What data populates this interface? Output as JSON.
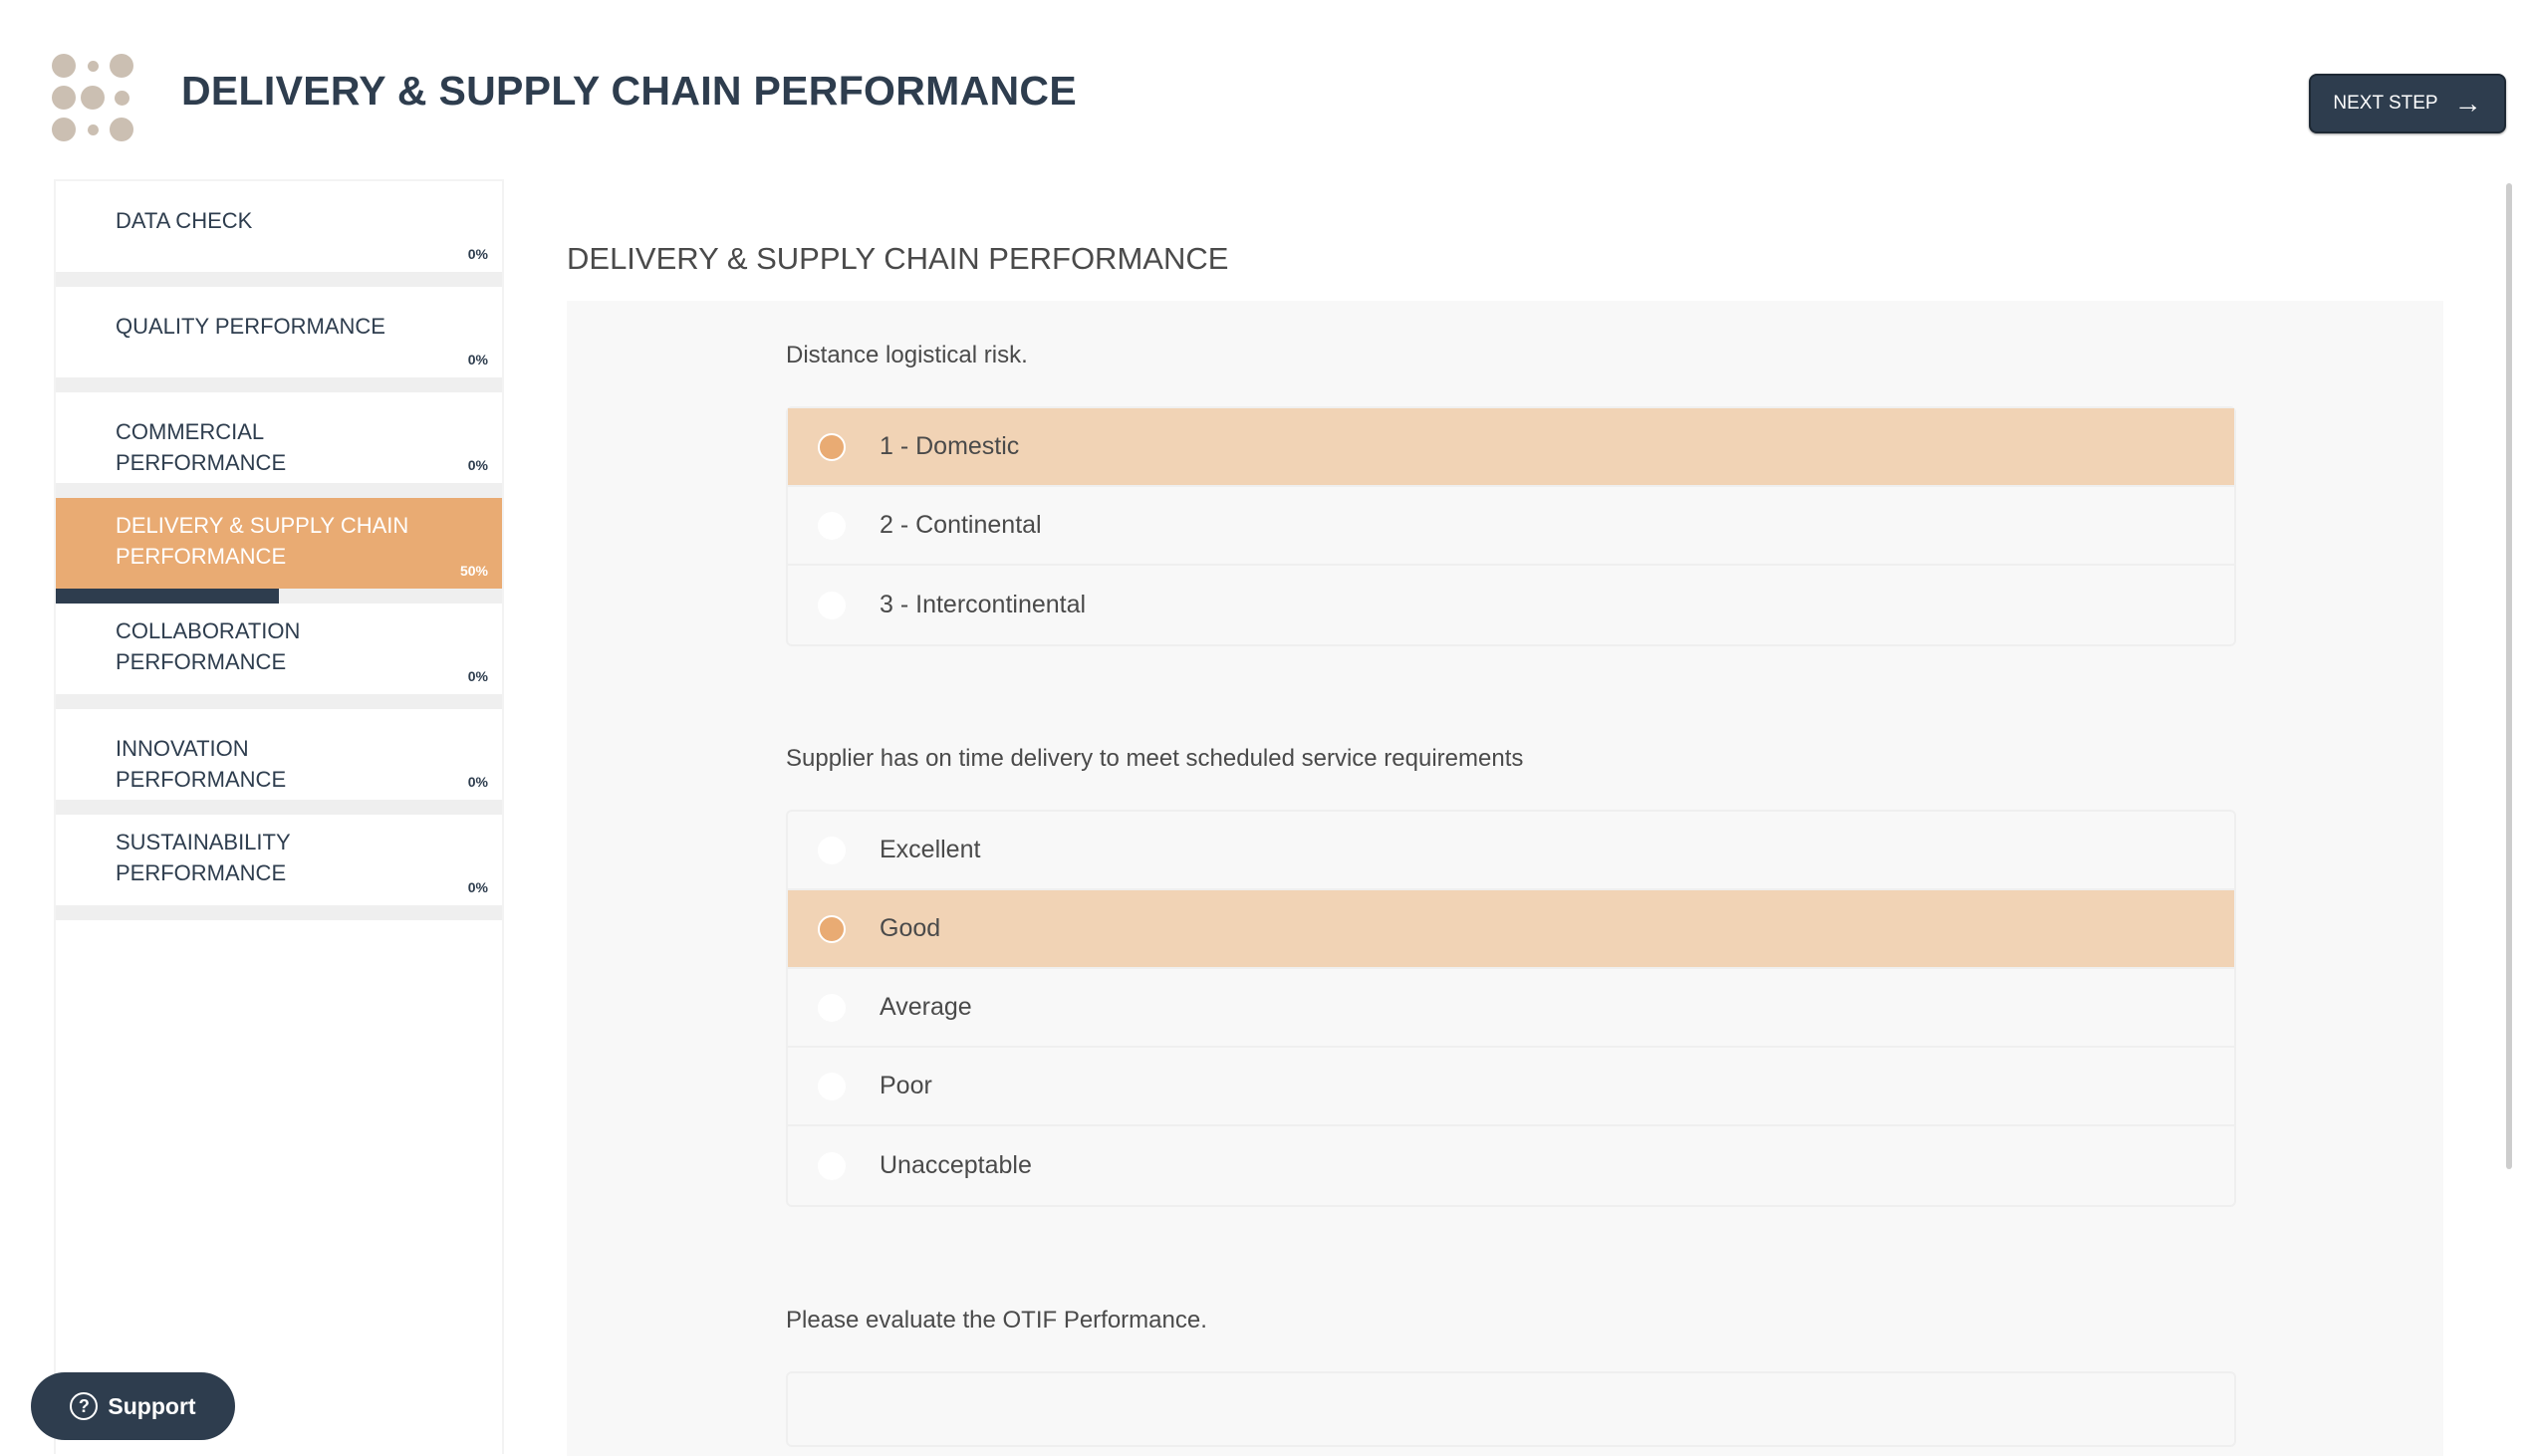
{
  "header": {
    "title": "DELIVERY & SUPPLY CHAIN PERFORMANCE",
    "next_button": "NEXT STEP",
    "logo_color": "#cbbfb2"
  },
  "sidebar": {
    "steps": [
      {
        "label": "DATA CHECK",
        "percent_label": "0%",
        "progress": 0,
        "active": false
      },
      {
        "label": "QUALITY PERFORMANCE",
        "percent_label": "0%",
        "progress": 0,
        "active": false
      },
      {
        "label": "COMMERCIAL PERFORMANCE",
        "percent_label": "0%",
        "progress": 0,
        "active": false
      },
      {
        "label": "DELIVERY & SUPPLY CHAIN PERFORMANCE",
        "percent_label": "50%",
        "progress": 0.5,
        "active": true
      },
      {
        "label": "COLLABORATION PERFORMANCE",
        "percent_label": "0%",
        "progress": 0,
        "active": false
      },
      {
        "label": "INNOVATION PERFORMANCE",
        "percent_label": "0%",
        "progress": 0,
        "active": false
      },
      {
        "label": "SUSTAINABILITY PERFORMANCE",
        "percent_label": "0%",
        "progress": 0,
        "active": false
      }
    ]
  },
  "main": {
    "section_title": "DELIVERY & SUPPLY CHAIN PERFORMANCE",
    "questions": [
      {
        "text": "Distance logistical risk.",
        "options": [
          "1 - Domestic",
          "2 - Continental",
          "3 - Intercontinental"
        ],
        "selected": 0
      },
      {
        "text": "Supplier has on time delivery to meet scheduled service requirements",
        "options": [
          "Excellent",
          "Good",
          "Average",
          "Poor",
          "Unacceptable"
        ],
        "selected": 1
      },
      {
        "text": "Please evaluate the OTIF Performance.",
        "options": [],
        "selected": null
      }
    ]
  },
  "support": {
    "label": "Support"
  },
  "colors": {
    "accent": "#e9ab73",
    "selected_bg": "#f1d3b5",
    "navy": "#2e3d4e"
  }
}
